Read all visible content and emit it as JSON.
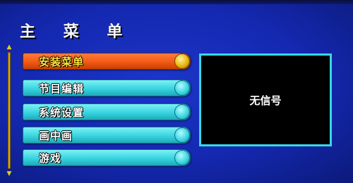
{
  "menu": {
    "title": "主 菜 单",
    "items": [
      {
        "label": "安装菜单",
        "selected": true
      },
      {
        "label": "节目编辑",
        "selected": false
      },
      {
        "label": "系统设置",
        "selected": false
      },
      {
        "label": "画中画",
        "selected": false
      },
      {
        "label": "游戏",
        "selected": false
      }
    ]
  },
  "preview": {
    "status_text": "无信号"
  },
  "icons": {
    "scroll_up": "up-arrow-icon",
    "scroll_down": "down-arrow-icon",
    "item_knob": "circle-indicator-icon"
  },
  "colors": {
    "background": "#1428b0",
    "item": "#37d4e0",
    "item_selected": "#f25a14",
    "selected_text": "#ffe23a",
    "scroll_track": "#d9a800"
  }
}
